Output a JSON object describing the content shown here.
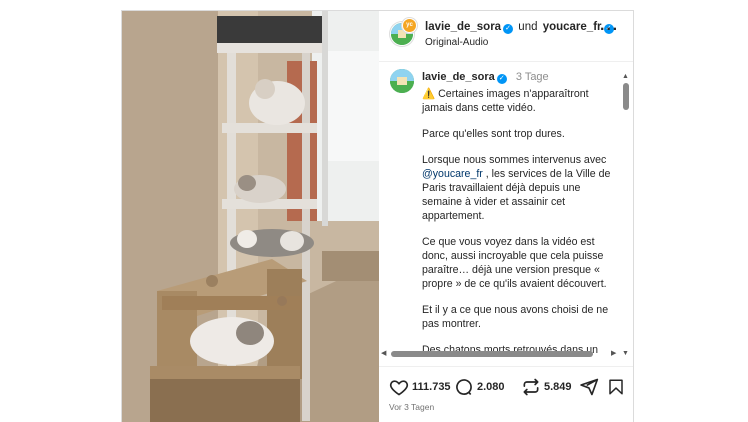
{
  "header": {
    "user1": "lavie_de_sora",
    "connector": "und",
    "user2": "youcare_fr",
    "audio": "Original-Audio"
  },
  "caption": {
    "user": "lavie_de_sora",
    "time": "3 Tage",
    "warning_icon": "⚠️",
    "line1": "Certaines images n'apparaîtront jamais dans cette vidéo.",
    "para2": "Parce qu'elles sont trop dures.",
    "para3_pre": "Lorsque nous sommes intervenus avec",
    "para3_mention": "@youcare_fr",
    "para3_post": ", les services de la Ville de Paris travaillaient déjà depuis une semaine à vider et assainir cet appartement.",
    "para4": "Ce que vous voyez dans la vidéo est donc, aussi incroyable que cela puisse paraître… déjà une version presque « propre » de ce qu'ils avaient découvert.",
    "para5": "Et il y a ce que nous avons choisi de ne pas montrer.",
    "para6": "Des chatons morts retrouvés dans un"
  },
  "actions": {
    "likes": "111.735",
    "comments": "2.080",
    "reposts": "5.849"
  },
  "posted": "Vor 3 Tagen",
  "icons": [
    "verified-badge-icon",
    "more-icon",
    "warning-icon",
    "heart-icon",
    "comment-icon",
    "repost-icon",
    "share-icon",
    "bookmark-icon"
  ]
}
